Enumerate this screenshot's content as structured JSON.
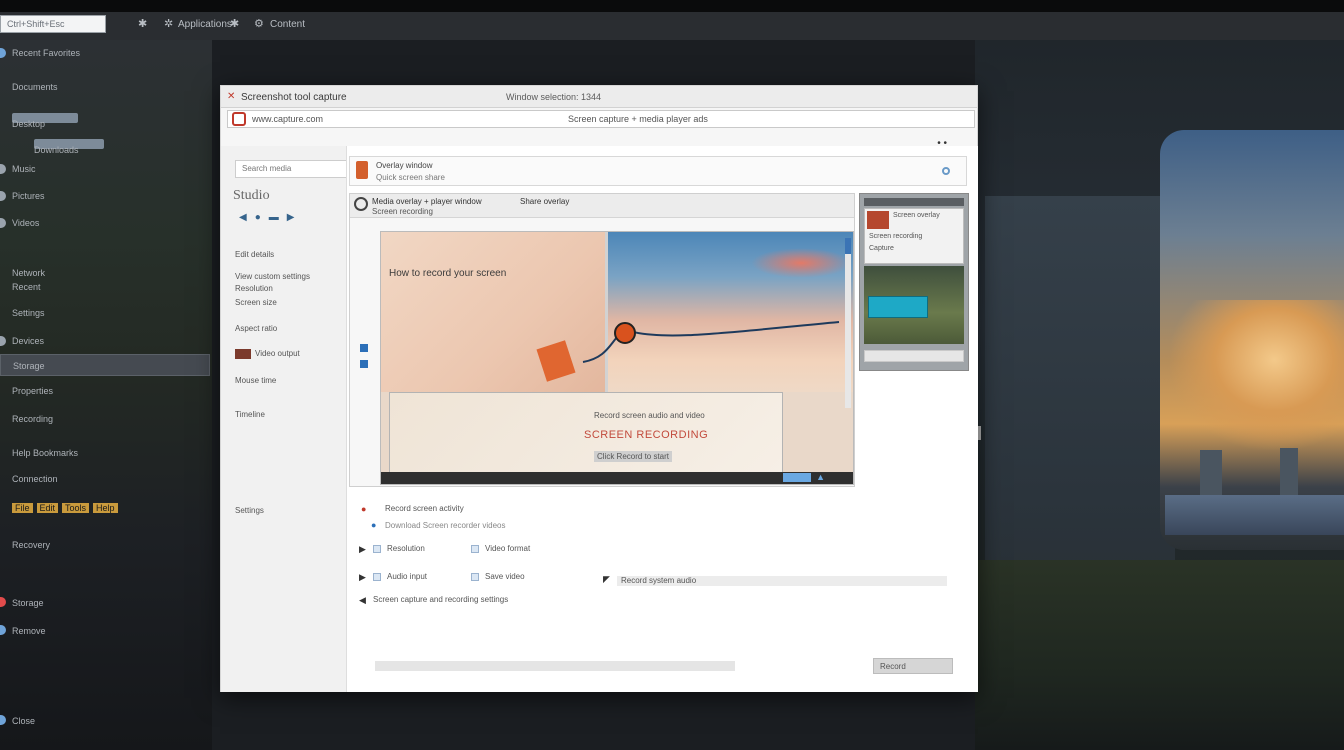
{
  "topbar": {
    "search_text": "Ctrl+Shift+Esc",
    "items": [
      "Applications",
      "Content"
    ]
  },
  "sidebar": {
    "items": [
      "Recent Favorites",
      "Documents",
      "Desktop",
      "Downloads",
      "Music",
      "Pictures",
      "Videos",
      "Network",
      "Recent",
      "Settings",
      "Devices",
      "Storage",
      "Properties",
      "Recording",
      "Help Bookmarks",
      "Connection",
      "Recovery",
      "Storage",
      "Remove",
      "Close"
    ],
    "gold_items": [
      "File",
      "Edit",
      "Tools",
      "Help"
    ]
  },
  "window": {
    "title": "Screenshot tool capture",
    "title2": "Window selection: 1344",
    "url": "www.capture.com",
    "url2": "Screen capture + media player ads",
    "tools": "• •"
  },
  "window_left": {
    "search": "Search media",
    "brand": "Studio",
    "icons": "◀●▬▶",
    "items": [
      "Edit details",
      "View custom settings",
      "Resolution",
      "Screen size",
      "Aspect ratio",
      "Video output",
      "Mouse time",
      "Timeline"
    ],
    "bottom": "Settings"
  },
  "content": {
    "header_t1": "Overlay window",
    "header_t2": "Quick screen share",
    "player_t1": "Media overlay + player window",
    "player_t2": "Screen recording",
    "player_t3": "Share overlay",
    "video_caption": "How to record your screen",
    "panel_t1": "Record screen audio and video",
    "panel_t2": "SCREEN RECORDING",
    "panel_t3": "Click Record to start",
    "side_t1": "Screen overlay",
    "side_t2": "Screen recording",
    "side_t3": "Capture",
    "rows": [
      "Record screen activity",
      "Download Screen recorder videos",
      "Resolution",
      "Video format",
      "Audio input",
      "Save video",
      "Screen capture and recording settings",
      "Record system audio"
    ],
    "footer_btn": "Record"
  },
  "colors": {
    "accent": "#d9521e",
    "link": "#2c6fb8",
    "panel_red": "#c24a3c"
  }
}
